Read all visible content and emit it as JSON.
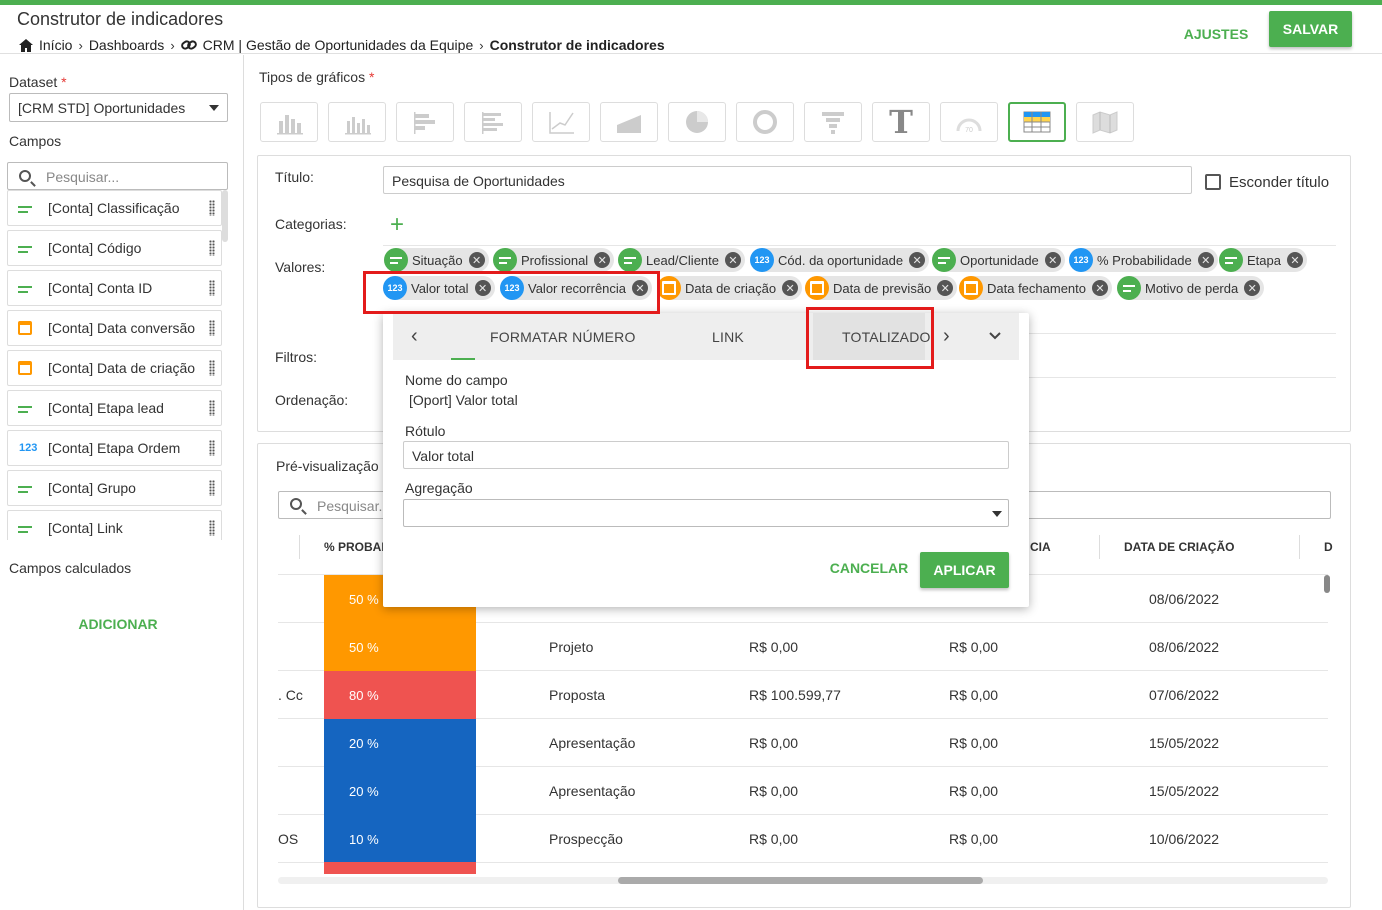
{
  "header": {
    "title": "Construtor de indicadores",
    "breadcrumb": [
      "Início",
      "Dashboards",
      "CRM | Gestão de Oportunidades da Equipe",
      "Construtor de indicadores"
    ],
    "adjust_label": "AJUSTES",
    "save_label": "SALVAR"
  },
  "sidebar": {
    "dataset_label": "Dataset",
    "dataset_value": "[CRM STD] Oportunidades",
    "fields_label": "Campos",
    "search_placeholder": "Pesquisar...",
    "fields": [
      {
        "label": "[Conta] Classificação",
        "type": "text"
      },
      {
        "label": "[Conta] Código",
        "type": "text"
      },
      {
        "label": "[Conta] Conta ID",
        "type": "text"
      },
      {
        "label": "[Conta] Data conversão",
        "type": "date"
      },
      {
        "label": "[Conta] Data de criação",
        "type": "date"
      },
      {
        "label": "[Conta] Etapa lead",
        "type": "text"
      },
      {
        "label": "[Conta] Etapa Ordem",
        "type": "number",
        "badge": "123"
      },
      {
        "label": "[Conta] Grupo",
        "type": "text"
      },
      {
        "label": "[Conta] Link",
        "type": "text"
      }
    ],
    "calculated_label": "Campos calculados",
    "add_label": "ADICIONAR"
  },
  "chart_types": {
    "label": "Tipos de gráficos",
    "icons": [
      "column-chart-icon",
      "stacked-column-chart-icon",
      "bar-chart-icon",
      "stacked-bar-chart-icon",
      "line-chart-icon",
      "area-chart-icon",
      "pie-chart-icon",
      "donut-chart-icon",
      "funnel-chart-icon",
      "text-chart-icon",
      "gauge-chart-icon",
      "table-chart-icon",
      "map-chart-icon"
    ],
    "active": "table-chart-icon",
    "text_glyph": "T",
    "gauge_value": "70"
  },
  "config": {
    "title_label": "Título:",
    "title_value": "Pesquisa de Oportunidades",
    "hide_title_label": "Esconder título",
    "categories_label": "Categorias:",
    "values_label": "Valores:",
    "filters_label": "Filtros:",
    "order_label": "Ordenação:",
    "chips": [
      {
        "label": "Situação",
        "type": "t"
      },
      {
        "label": "Profissional",
        "type": "t"
      },
      {
        "label": "Lead/Cliente",
        "type": "t"
      },
      {
        "label": "Cód. da oportunidade",
        "type": "n"
      },
      {
        "label": "Oportunidade",
        "type": "t"
      },
      {
        "label": "% Probabilidade",
        "type": "n"
      },
      {
        "label": "Etapa",
        "type": "t"
      },
      {
        "label": "Valor total",
        "type": "n"
      },
      {
        "label": "Valor recorrência",
        "type": "n"
      },
      {
        "label": "Data de criação",
        "type": "d"
      },
      {
        "label": "Data de previsão",
        "type": "d"
      },
      {
        "label": "Data fechamento",
        "type": "d"
      },
      {
        "label": "Motivo de perda",
        "type": "t"
      }
    ],
    "badge_number": "123",
    "remove_glyph": "✕"
  },
  "popup": {
    "tabs": [
      "FORMATAR NÚMERO",
      "LINK",
      "TOTALIZADO"
    ],
    "field_name_label": "Nome do campo",
    "field_name_value": "[Oport] Valor total",
    "label_label": "Rótulo",
    "label_value": "Valor total",
    "aggregation_label": "Agregação",
    "aggregation_value": "",
    "cancel_label": "CANCELAR",
    "apply_label": "APLICAR"
  },
  "preview": {
    "label": "Pré-visualização",
    "search_placeholder": "Pesquisar...",
    "columns": [
      "% PROBAB",
      "CIA",
      "DATA DE CRIAÇÃO",
      "D"
    ],
    "rows": [
      {
        "left": "",
        "prob": "50 %",
        "prob_color": "#ff9800",
        "etapa": "",
        "v1": "",
        "v2": "",
        "date": "08/06/2022"
      },
      {
        "left": "",
        "prob": "50 %",
        "prob_color": "#ff9800",
        "etapa": "Projeto",
        "v1": "R$ 0,00",
        "v2": "R$ 0,00",
        "date": "08/06/2022"
      },
      {
        "left": ". Cc",
        "prob": "80 %",
        "prob_color": "#ef5350",
        "etapa": "Proposta",
        "v1": "R$ 100.599,77",
        "v2": "R$ 0,00",
        "date": "07/06/2022"
      },
      {
        "left": "",
        "prob": "20 %",
        "prob_color": "#1565c0",
        "etapa": "Apresentação",
        "v1": "R$ 0,00",
        "v2": "R$ 0,00",
        "date": "15/05/2022"
      },
      {
        "left": "",
        "prob": "20 %",
        "prob_color": "#1565c0",
        "etapa": "Apresentação",
        "v1": "R$ 0,00",
        "v2": "R$ 0,00",
        "date": "15/05/2022"
      },
      {
        "left": "OS",
        "prob": "10 %",
        "prob_color": "#1565c0",
        "etapa": "Prospecção",
        "v1": "R$ 0,00",
        "v2": "R$ 0,00",
        "date": "10/06/2022"
      }
    ]
  }
}
